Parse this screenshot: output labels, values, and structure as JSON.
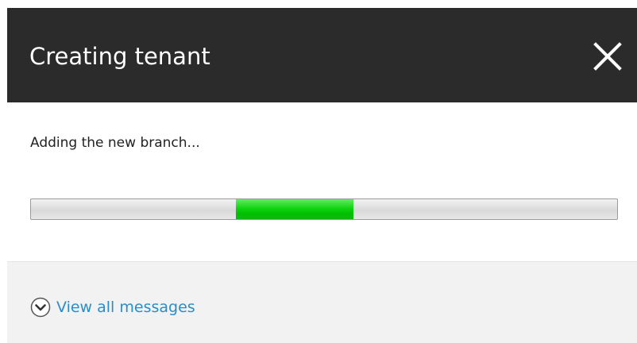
{
  "header": {
    "title": "Creating tenant",
    "close_icon": "close-icon"
  },
  "body": {
    "status_text": "Adding the new branch...",
    "progress": {
      "indeterminate": true,
      "fill_start_fraction": 0.35,
      "fill_end_fraction": 0.55,
      "fill_color": "#00c000"
    }
  },
  "footer": {
    "messages_label": "View all messages",
    "messages_icon": "chevron-down-circle-icon",
    "link_color": "#2a8dc8"
  },
  "colors": {
    "header_bg": "#2b2b2b",
    "footer_bg": "#f2f2f2"
  }
}
